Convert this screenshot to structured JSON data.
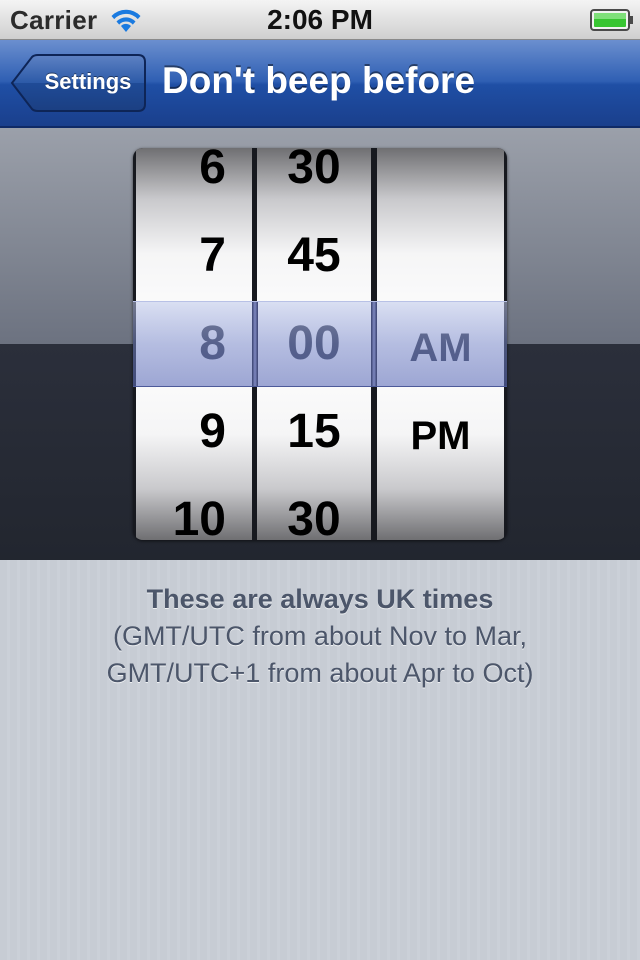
{
  "status_bar": {
    "carrier": "Carrier",
    "time": "2:06 PM",
    "wifi_icon": "wifi-icon",
    "battery_icon": "battery-icon",
    "battery_color": "#38c531"
  },
  "nav_bar": {
    "back_label": "Settings",
    "title": "Don't beep before",
    "tint_color": "#1f4fa5"
  },
  "picker": {
    "hours": [
      "6",
      "7",
      "8",
      "9",
      "10"
    ],
    "minutes": [
      "30",
      "45",
      "00",
      "15",
      "30"
    ],
    "meridiem": [
      "AM",
      "PM"
    ],
    "selected_hour": "8",
    "selected_minute": "00",
    "selected_meridiem": "AM",
    "selection_color": "#7a87c8"
  },
  "note": {
    "heading": "These are always UK times",
    "line1": "(GMT/UTC from about Nov to Mar,",
    "line2": "GMT/UTC+1 from about Apr to Oct)"
  }
}
